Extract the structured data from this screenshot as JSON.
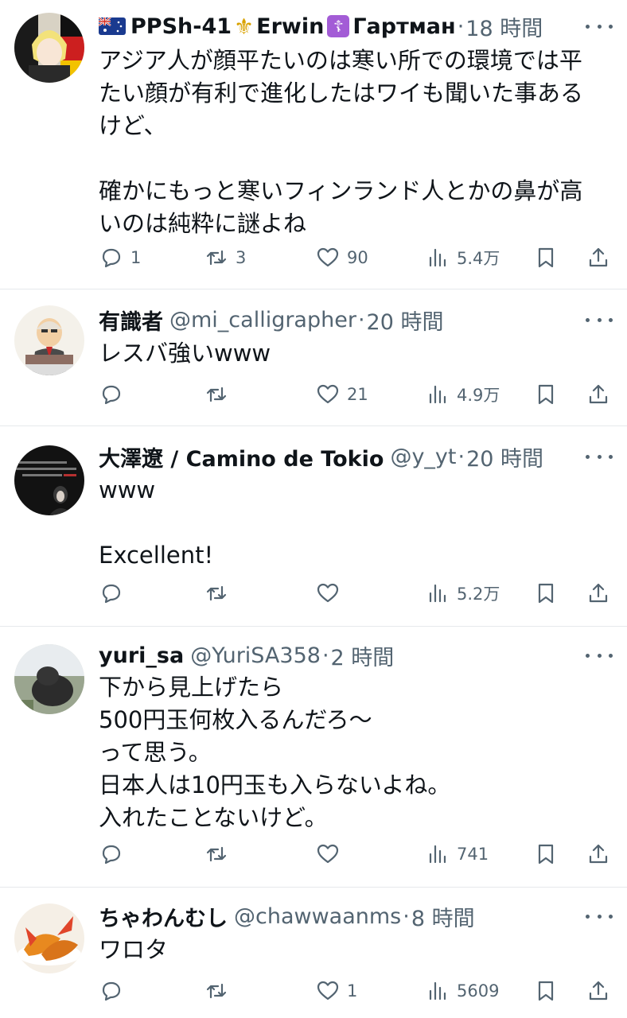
{
  "tweets": [
    {
      "name": "PPSh-41",
      "name2": "Erwin",
      "name3": "Гартман",
      "flag_icon": "australia-flag-icon",
      "fleur_icon": "fleur-de-lis-icon",
      "cross_icon": "orthodox-cross-icon",
      "fleur_glyph": "⚜",
      "cross_glyph": "☦",
      "sep": "·",
      "time": "18 時間",
      "text": "アジア人が顔平たいのは寒い所での環境では平たい顔が有利で進化したはワイも聞いた事あるけど、\n\n確かにもっと寒いフィンランド人とかの鼻が高いのは純粋に謎よね",
      "replies": "1",
      "retweets": "3",
      "likes": "90",
      "views": "5.4万"
    },
    {
      "name": "有識者",
      "handle": "@mi_calligrapher",
      "sep": "·",
      "time": "20 時間",
      "text": "レスバ強いwww",
      "replies": "",
      "retweets": "",
      "likes": "21",
      "views": "4.9万"
    },
    {
      "name": "大澤遼 / Camino de Tokio",
      "handle": "@y_yt",
      "sep": "·",
      "time": "20 時間",
      "text": "www\n\nExcellent!",
      "replies": "",
      "retweets": "",
      "likes": "",
      "views": "5.2万"
    },
    {
      "name": "yuri_sa",
      "handle": "@YuriSA358",
      "sep": "·",
      "time": "2 時間",
      "text": "下から見上げたら\n500円玉何枚入るんだろ〜\nって思う。\n日本人は10円玉も入らないよね。\n入れたことないけど。",
      "replies": "",
      "retweets": "",
      "likes": "",
      "views": "741"
    },
    {
      "name": "ちゃわんむし",
      "handle": "@chawwaanms",
      "sep": "·",
      "time": "8 時間",
      "text": "ワロタ",
      "replies": "",
      "retweets": "",
      "likes": "1",
      "views": "5609"
    }
  ]
}
